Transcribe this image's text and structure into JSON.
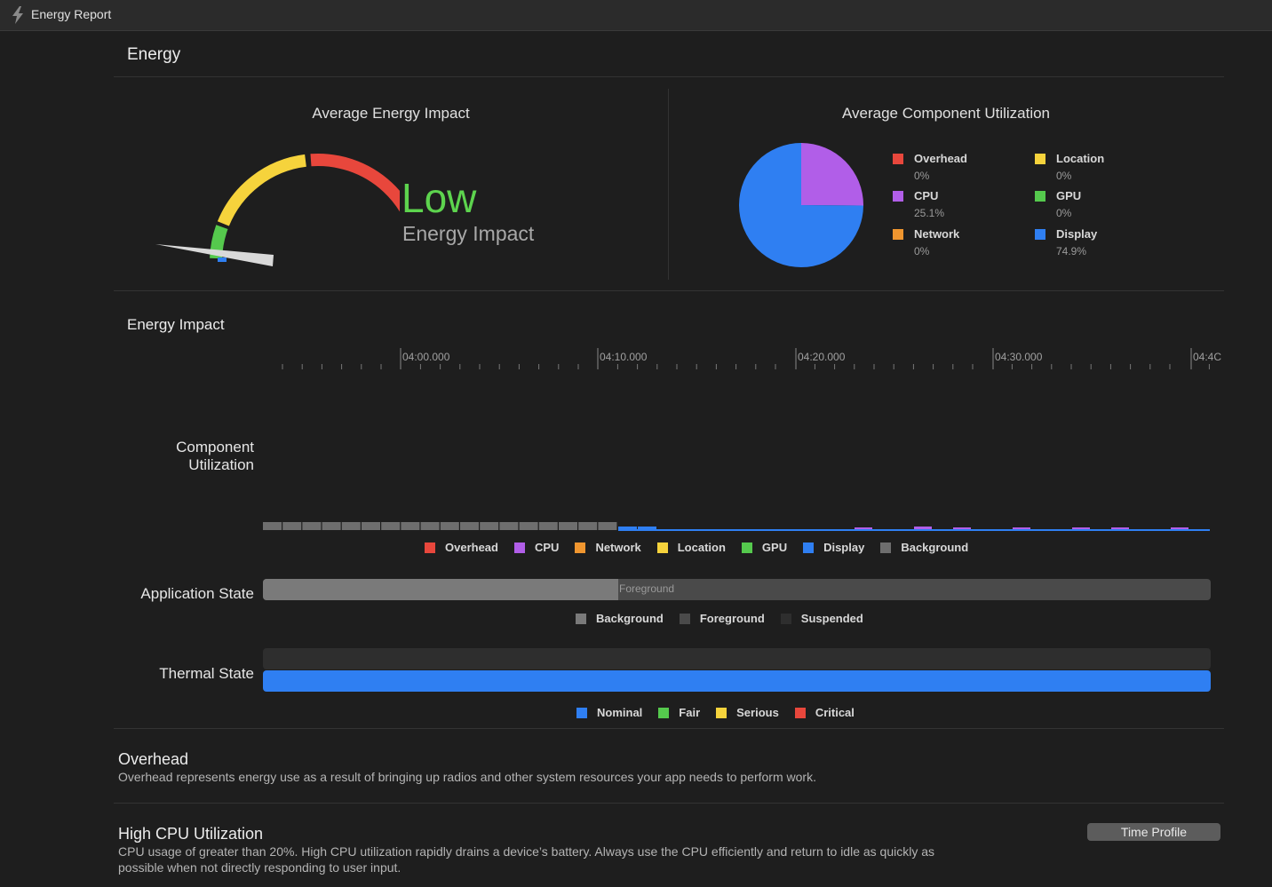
{
  "window": {
    "title": "Energy Report",
    "icon": "bolt-icon"
  },
  "header": {
    "title": "Energy"
  },
  "avg_energy_impact": {
    "title": "Average Energy Impact",
    "level": "Low",
    "subtitle": "Energy Impact",
    "gauge_needle_fraction": 0.03
  },
  "avg_component_utilization": {
    "title": "Average Component Utilization",
    "legend": [
      {
        "name": "Overhead",
        "value": "0%",
        "color": "#e8473c"
      },
      {
        "name": "Location",
        "value": "0%",
        "color": "#f6d33c"
      },
      {
        "name": "CPU",
        "value": "25.1%",
        "color": "#b15ee8"
      },
      {
        "name": "GPU",
        "value": "0%",
        "color": "#55c94d"
      },
      {
        "name": "Network",
        "value": "0%",
        "color": "#f0962f"
      },
      {
        "name": "Display",
        "value": "74.9%",
        "color": "#2f7ff2"
      }
    ],
    "chart_data": {
      "type": "pie",
      "categories": [
        "Display",
        "CPU"
      ],
      "values": [
        74.9,
        25.1
      ],
      "colors": [
        "#2f7ff2",
        "#b15ee8"
      ]
    }
  },
  "energy_impact": {
    "title": "Energy Impact",
    "ticks": [
      "04:00.000",
      "04:10.000",
      "04:20.000",
      "04:30.000",
      "04:4C"
    ]
  },
  "component_utilization": {
    "label_line1": "Component",
    "label_line2": "Utilization",
    "legend": [
      {
        "name": "Overhead",
        "color": "#e8473c"
      },
      {
        "name": "CPU",
        "color": "#b15ee8"
      },
      {
        "name": "Network",
        "color": "#f0962f"
      },
      {
        "name": "Location",
        "color": "#f6d33c"
      },
      {
        "name": "GPU",
        "color": "#55c94d"
      },
      {
        "name": "Display",
        "color": "#2f7ff2"
      },
      {
        "name": "Background",
        "color": "#6e6e6e"
      }
    ]
  },
  "application_state": {
    "label": "Application State",
    "bar_text": "Foreground",
    "legend": [
      {
        "name": "Background",
        "color": "#7a7a7a"
      },
      {
        "name": "Foreground",
        "color": "#4a4a4a"
      },
      {
        "name": "Suspended",
        "color": "#2e2e2e"
      }
    ]
  },
  "thermal_state": {
    "label": "Thermal State",
    "legend": [
      {
        "name": "Nominal",
        "color": "#2f7ff2"
      },
      {
        "name": "Fair",
        "color": "#55c94d"
      },
      {
        "name": "Serious",
        "color": "#f6d33c"
      },
      {
        "name": "Critical",
        "color": "#e8473c"
      }
    ]
  },
  "overhead_info": {
    "title": "Overhead",
    "text": "Overhead represents energy use as a result of bringing up radios and other system resources your app needs to perform work."
  },
  "cpu_info": {
    "title": "High CPU Utilization",
    "text_line1": "CPU usage of greater than 20%. High CPU utilization rapidly drains a device’s battery. Always use the CPU efficiently and return to idle as quickly as",
    "text_line2": "possible when not directly responding to user input.",
    "button": "Time Profile"
  }
}
